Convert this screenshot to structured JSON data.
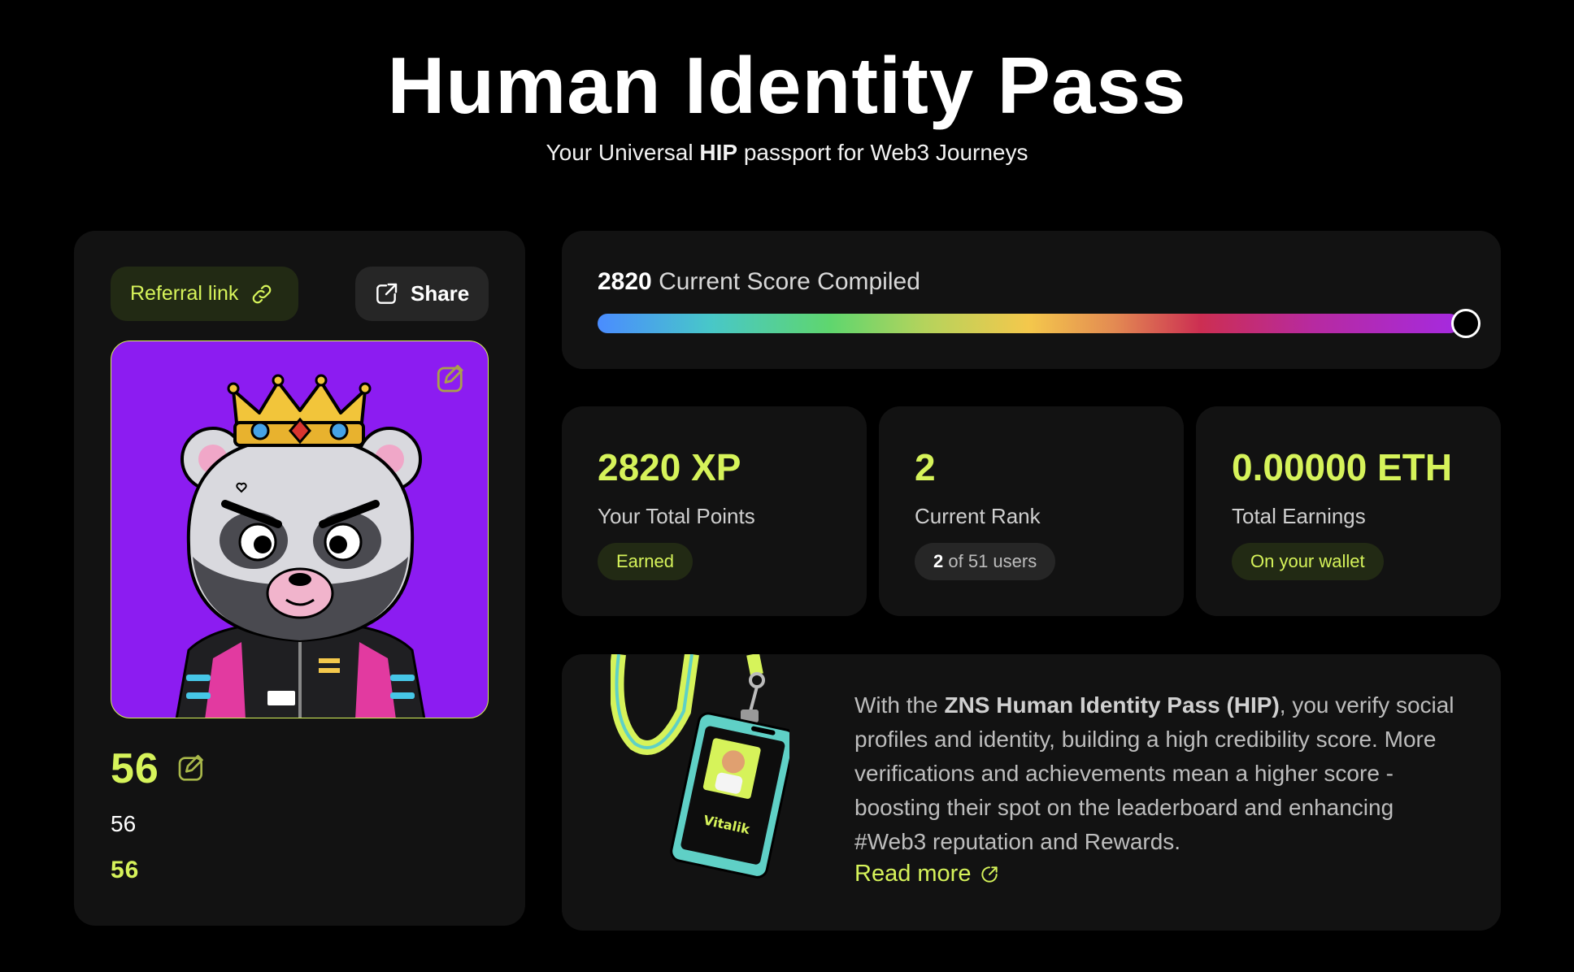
{
  "hero": {
    "title": "Human Identity Pass",
    "subtitle_prefix": "Your Universal ",
    "subtitle_bold": "HIP",
    "subtitle_suffix": " passport for Web3 Journeys"
  },
  "profile": {
    "referral_label": "Referral link",
    "share_label": "Share",
    "name_large": "56",
    "name_plain": "56",
    "name_green": "56"
  },
  "score": {
    "value": "2820",
    "label": " Current Score Compiled",
    "progress": 1.0
  },
  "stats": [
    {
      "value": "2820 XP",
      "label": "Your Total Points",
      "badge": "Earned"
    },
    {
      "value": "2",
      "label": "Current Rank",
      "badge_bold": "2",
      "badge_rest": " of 51 users"
    },
    {
      "value": "0.00000 ETH",
      "label": "Total Earnings",
      "badge": "On your wallet"
    }
  ],
  "info": {
    "text_prefix": "With the ",
    "text_bold": "ZNS Human Identity Pass (HIP)",
    "text_rest": ", you verify social profiles and identity, building a high credibility score. More verifications and achievements mean a higher score - boosting their spot on the leaderboard and enhancing #Web3 reputation and Rewards.",
    "read_more": "Read more",
    "badge_name": "Vitalik"
  },
  "colors": {
    "accent": "#d6f35a",
    "card": "#121212",
    "avatar_bg": "#8c1cf1"
  },
  "icons": [
    "link-icon",
    "share-icon",
    "edit-icon",
    "external-link-icon"
  ]
}
